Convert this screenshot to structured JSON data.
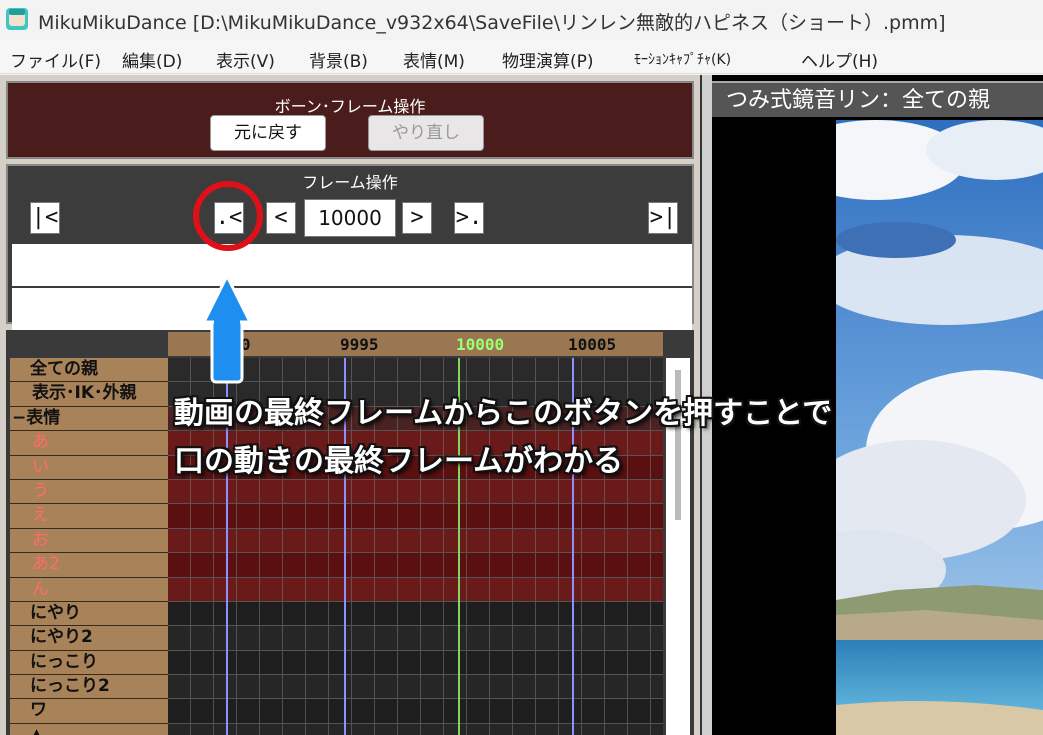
{
  "window": {
    "title": "MikuMikuDance [D:\\MikuMikuDance_v932x64\\SaveFile\\リンレン無敵的ハピネス（ショート）.pmm]"
  },
  "menu": [
    "ファイル(F)",
    "編集(D)",
    "表示(V)",
    "背景(B)",
    "表情(M)",
    "物理演算(P)",
    "ﾓｰｼｮﾝｷｬﾌﾟﾁｬ(K)",
    "ヘルプ(H)"
  ],
  "bone_frame": {
    "title": "ボーン･フレーム操作",
    "undo_label": "元に戻す",
    "redo_label": "やり直し"
  },
  "frame_ops": {
    "title": "フレーム操作",
    "first_label": "|<",
    "prev_key_label": ".<",
    "prev_label": "<",
    "frame_value": "10000",
    "next_label": ">",
    "next_key_label": ">.",
    "last_label": ">|"
  },
  "ruler": [
    "9990",
    "9995",
    "10000",
    "10005"
  ],
  "tracks": [
    {
      "label": "全ての親",
      "kind": "bone"
    },
    {
      "label": "表示･IK･外親",
      "kind": "bone"
    },
    {
      "label": "−表情",
      "kind": "cat"
    },
    {
      "label": "あ",
      "kind": "morph"
    },
    {
      "label": "い",
      "kind": "morph"
    },
    {
      "label": "う",
      "kind": "morph"
    },
    {
      "label": "え",
      "kind": "morph"
    },
    {
      "label": "お",
      "kind": "morph"
    },
    {
      "label": "あ2",
      "kind": "morph"
    },
    {
      "label": "ん",
      "kind": "morph"
    },
    {
      "label": "にやり",
      "kind": "bone"
    },
    {
      "label": "にやり2",
      "kind": "bone"
    },
    {
      "label": "にっこり",
      "kind": "bone"
    },
    {
      "label": "にっこり2",
      "kind": "bone"
    },
    {
      "label": "ワ",
      "kind": "bone"
    },
    {
      "label": "▲",
      "kind": "bone"
    }
  ],
  "model_title": "つみ式鏡音リン：全ての親",
  "annotation": {
    "line1": "動画の最終フレームからこのボタンを押すことで",
    "line2": "口の動きの最終フレームがわかる"
  },
  "colors": {
    "highlight_circle": "#e0101a",
    "arrow": "#1e8ff0",
    "current_frame_line": "#7ed860",
    "bone_panel": "#4a1c1c",
    "morph_row": "#6b1212"
  }
}
